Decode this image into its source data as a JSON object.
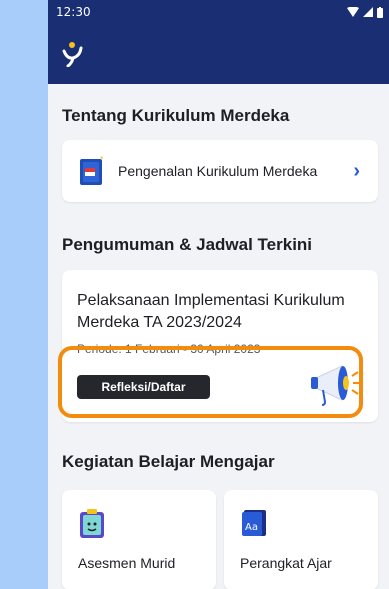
{
  "status_bar": {
    "time": "12:30"
  },
  "app_bar": {
    "logo_icon": "merdeka-logo-icon"
  },
  "sections": {
    "about_title": "Tentang Kurikulum Merdeka",
    "announcements_title": "Pengumuman & Jadwal Terkini",
    "activities_title": "Kegiatan Belajar Mengajar"
  },
  "about_card": {
    "label": "Pengenalan Kurikulum Merdeka",
    "icon": "book-icon"
  },
  "announcement": {
    "title": "Pelaksanaan Implementasi Kurikulum Merdeka TA 2023/2024",
    "period": "Periode: 1 Februari - 30 April 2023",
    "button_label": "Refleksi/Daftar",
    "icon": "megaphone-icon"
  },
  "tiles": [
    {
      "label": "Asesmen Murid",
      "icon": "clipboard-icon"
    },
    {
      "label": "Perangkat Ajar",
      "icon": "textbook-icon"
    }
  ],
  "colors": {
    "app_bar": "#1a2f73",
    "highlight": "#f28c0f",
    "accent": "#2a5bd7"
  }
}
